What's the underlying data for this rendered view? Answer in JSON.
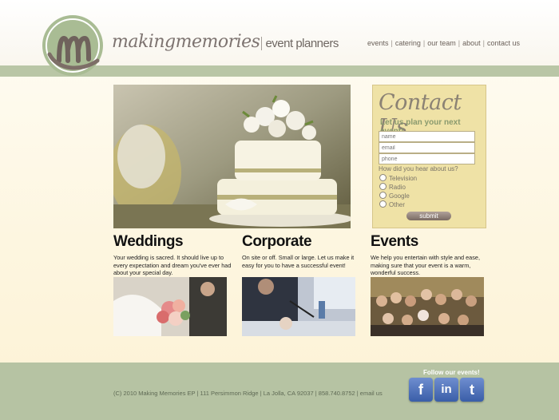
{
  "brand": {
    "name": "makingmemories",
    "tagline": "event planners"
  },
  "nav": {
    "items": [
      "events",
      "catering",
      "our team",
      "about",
      "contact us"
    ]
  },
  "contact": {
    "title": "Contact Us",
    "subtitle": "Let us plan your next event!",
    "name_placeholder": "name",
    "email_placeholder": "email",
    "phone_placeholder": "phone",
    "question": "How did you hear about us?",
    "options": [
      "Television",
      "Radio",
      "Google",
      "Other"
    ],
    "submit_label": "submit"
  },
  "sections": [
    {
      "title": "Weddings",
      "text": "Your wedding is sacred. It should live up to every expectation and dream you've ever had about your special day."
    },
    {
      "title": "Corporate",
      "text": "On site or off. Small or large. Let us make it easy for you to have a successful event!"
    },
    {
      "title": "Events",
      "text": "We help you entertain with style and ease, making sure that your event is a warm, wonderful success."
    }
  ],
  "footer": {
    "copyright": "(C) 2010 Making Memories EP | 111 Persimmon Ridge | La Jolla, CA 92037 | 858.740.8752 | email us",
    "follow": "Follow our events!",
    "social": [
      "f",
      "in",
      "t"
    ]
  },
  "colors": {
    "green_band": "#b9c6a6",
    "footer_green": "#b6c3a3",
    "contact_panel": "#efe2a6",
    "social_blue": "#3a5ea8"
  }
}
